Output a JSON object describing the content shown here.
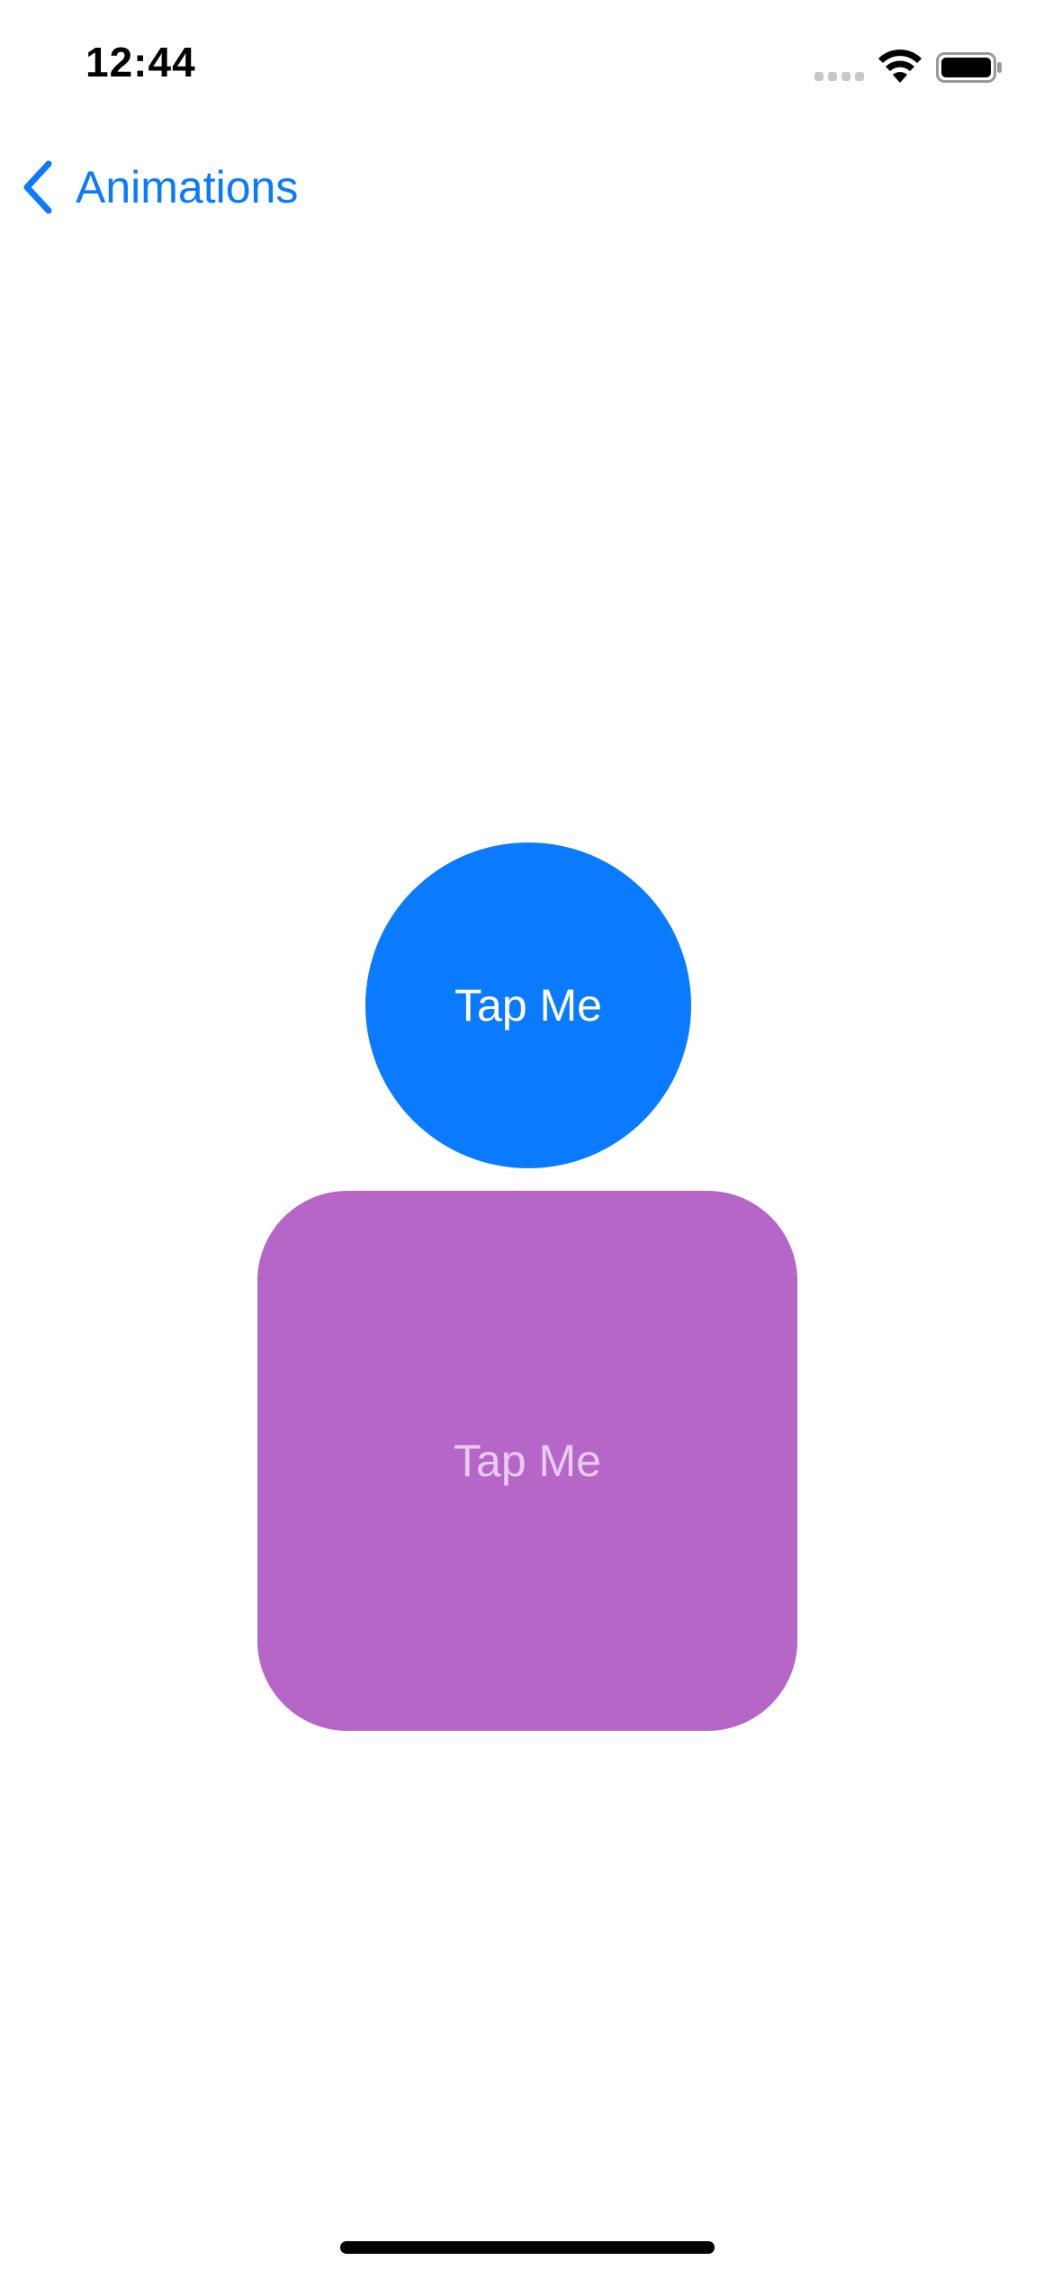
{
  "status_bar": {
    "time": "12:44",
    "icons": [
      "cellular-signal-icon",
      "wifi-icon",
      "battery-icon"
    ]
  },
  "nav": {
    "back_icon": "chevron-left-icon",
    "back_label": "Animations"
  },
  "circle_button": {
    "label": "Tap Me",
    "color": "#0a7aff",
    "text_color": "#ffffff"
  },
  "square_button": {
    "label": "Tap Me",
    "color": "#b566c7",
    "text_color": "#e9cbef"
  },
  "colors": {
    "accent": "#0a7aff",
    "background": "#ffffff"
  }
}
